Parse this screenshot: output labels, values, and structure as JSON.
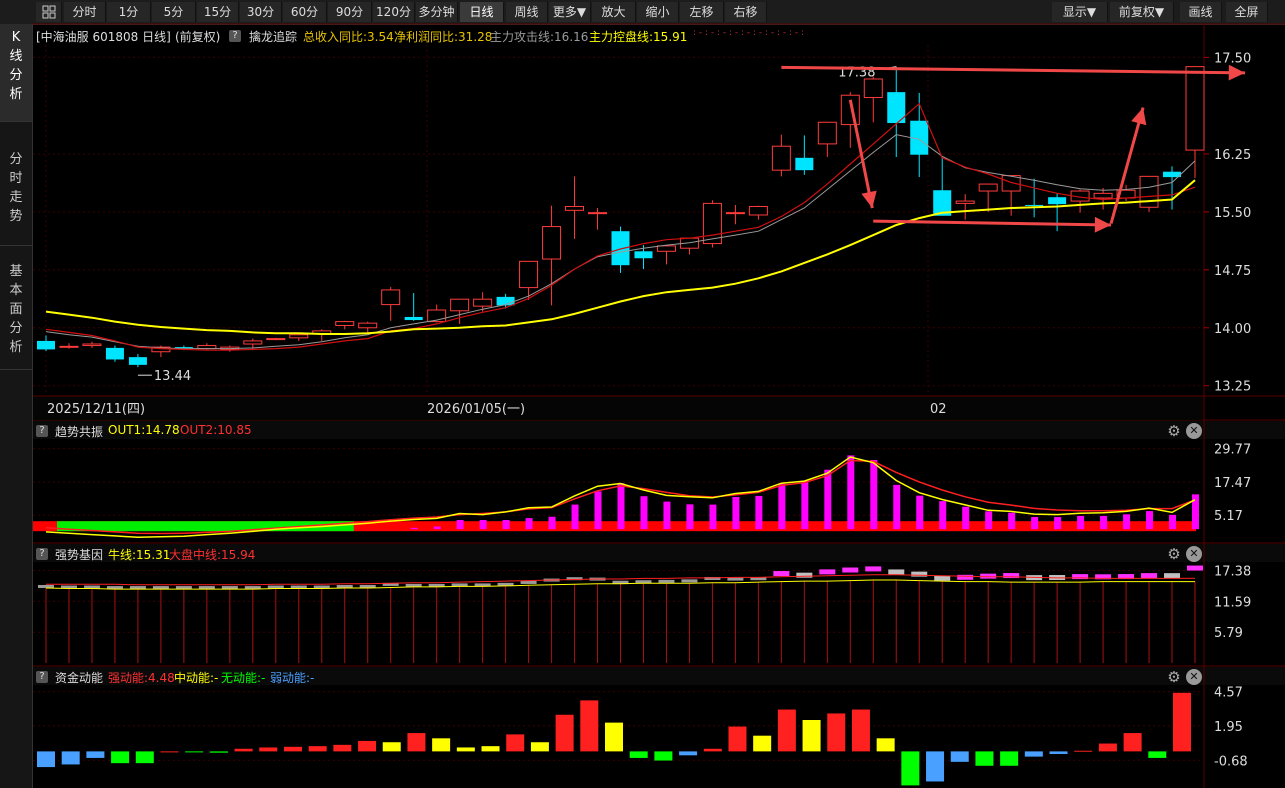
{
  "toolbar": {
    "items": [
      "分时",
      "1分",
      "5分",
      "15分",
      "30分",
      "60分",
      "90分",
      "120分",
      "多分钟",
      "日线",
      "周线",
      "更多▼",
      "放大",
      "缩小",
      "左移",
      "右移"
    ],
    "active": "日线",
    "right_items": [
      "显示▼",
      "前复权▼",
      "画线",
      "全屏"
    ]
  },
  "sidebar": {
    "tabs": [
      {
        "label": "K线分析",
        "chars": [
          "K",
          "线",
          "分",
          "析"
        ],
        "active": true
      },
      {
        "label": "分时走势",
        "chars": [
          "分",
          "时",
          "走",
          "势"
        ],
        "active": false
      },
      {
        "label": "基本面分析",
        "chars": [
          "基",
          "本",
          "面",
          "分",
          "析"
        ],
        "active": false
      }
    ]
  },
  "main_panel": {
    "title": "[中海油服 601808 日线]",
    "adjust": "(前复权)",
    "indicator_name": "擒龙追踪",
    "items": [
      {
        "text": "总收入同比:3.54",
        "color": "#e8c400"
      },
      {
        "text": "净利润同比:31.28",
        "color": "#e8c400"
      },
      {
        "text": "主力攻击线:16.16",
        "color": "#9a9a9a"
      },
      {
        "text": "主力控盘线:15.91",
        "color": "#ffff00"
      }
    ],
    "y_ticks": [
      "17.50",
      "16.25",
      "15.50",
      "14.75",
      "14.00",
      "13.25"
    ],
    "x_labels": [
      "2025/12/11(四)",
      "2026/01/05(一)",
      "02"
    ],
    "high_label": "17.38",
    "low_label": "13.44"
  },
  "chart_data": {
    "type": "candlestick",
    "open": [
      13.83,
      13.76,
      13.77,
      13.74,
      13.62,
      13.69,
      13.75,
      13.73,
      13.72,
      13.79,
      13.86,
      13.87,
      13.92,
      14.03,
      14.0,
      14.3,
      14.14,
      14.08,
      14.22,
      14.28,
      14.4,
      14.52,
      14.89,
      15.52,
      15.48,
      15.25,
      14.99,
      14.99,
      15.03,
      15.09,
      15.49,
      15.46,
      16.04,
      16.2,
      16.38,
      16.63,
      16.98,
      17.05,
      16.68,
      15.78,
      15.61,
      15.77,
      15.77,
      15.59,
      15.69,
      15.64,
      15.68,
      15.68,
      15.56,
      16.02,
      16.3
    ],
    "high": [
      13.9,
      13.8,
      13.82,
      13.77,
      13.66,
      13.77,
      13.77,
      13.8,
      13.77,
      13.86,
      13.87,
      13.92,
      13.98,
      14.09,
      14.08,
      14.53,
      14.45,
      14.3,
      14.35,
      14.46,
      14.44,
      14.55,
      15.58,
      15.96,
      15.55,
      15.31,
      15.07,
      15.05,
      15.14,
      15.65,
      15.59,
      15.58,
      16.5,
      16.49,
      16.62,
      17.05,
      17.25,
      17.38,
      17.04,
      16.22,
      15.73,
      15.77,
      15.97,
      15.93,
      15.74,
      15.79,
      15.81,
      15.85,
      15.95,
      16.09,
      16.41
    ],
    "low": [
      13.7,
      13.73,
      13.74,
      13.56,
      13.49,
      13.62,
      13.71,
      13.72,
      13.69,
      13.71,
      13.84,
      13.83,
      13.83,
      13.98,
      13.94,
      14.09,
      14.09,
      14.07,
      14.05,
      14.21,
      14.25,
      14.36,
      14.29,
      15.15,
      15.27,
      14.71,
      14.76,
      14.82,
      14.95,
      15.04,
      15.34,
      15.4,
      15.96,
      15.98,
      16.21,
      16.33,
      16.66,
      16.21,
      15.95,
      15.45,
      15.4,
      15.5,
      15.45,
      15.43,
      15.25,
      15.49,
      15.53,
      15.64,
      15.5,
      15.53,
      15.94
    ],
    "close": [
      13.72,
      13.76,
      13.79,
      13.59,
      13.52,
      13.75,
      13.74,
      13.77,
      13.75,
      13.83,
      13.86,
      13.91,
      13.96,
      14.08,
      14.06,
      14.49,
      14.1,
      14.23,
      14.37,
      14.37,
      14.29,
      14.86,
      15.31,
      15.57,
      15.49,
      14.81,
      14.9,
      15.06,
      15.16,
      15.61,
      15.49,
      15.57,
      16.35,
      16.04,
      16.66,
      17.01,
      17.22,
      16.65,
      16.24,
      15.45,
      15.64,
      15.86,
      15.97,
      15.58,
      15.6,
      15.77,
      15.74,
      15.78,
      15.96,
      15.95,
      17.38
    ],
    "ma_short": [
      13.98,
      13.94,
      13.9,
      13.83,
      13.75,
      13.73,
      13.72,
      13.71,
      13.71,
      13.72,
      13.73,
      13.75,
      13.79,
      13.83,
      13.86,
      13.96,
      13.99,
      14.05,
      14.13,
      14.2,
      14.26,
      14.38,
      14.55,
      14.76,
      14.93,
      15.02,
      15.09,
      15.14,
      15.16,
      15.2,
      15.25,
      15.3,
      15.44,
      15.62,
      15.86,
      16.12,
      16.38,
      16.64,
      16.9,
      16.2,
      16.08,
      15.99,
      15.88,
      15.81,
      15.74,
      15.69,
      15.66,
      15.68,
      15.7,
      15.72,
      15.82
    ],
    "ma_attack": [
      13.95,
      13.91,
      13.88,
      13.82,
      13.76,
      13.74,
      13.73,
      13.73,
      13.73,
      13.74,
      13.76,
      13.78,
      13.82,
      13.87,
      13.91,
      14.0,
      14.05,
      14.1,
      14.17,
      14.24,
      14.3,
      14.41,
      14.57,
      14.76,
      14.92,
      14.98,
      15.03,
      15.07,
      15.1,
      15.15,
      15.2,
      15.25,
      15.4,
      15.55,
      15.79,
      16.03,
      16.27,
      16.5,
      16.44,
      16.22,
      16.07,
      16.01,
      15.96,
      15.91,
      15.85,
      15.8,
      15.78,
      15.79,
      15.82,
      15.88,
      16.16
    ],
    "ma_control": [
      14.21,
      14.17,
      14.13,
      14.08,
      14.04,
      14.01,
      13.99,
      13.97,
      13.96,
      13.94,
      13.93,
      13.93,
      13.92,
      13.92,
      13.93,
      13.95,
      13.98,
      13.99,
      14.0,
      14.02,
      14.03,
      14.07,
      14.11,
      14.18,
      14.26,
      14.34,
      14.41,
      14.46,
      14.49,
      14.52,
      14.57,
      14.64,
      14.73,
      14.84,
      14.95,
      15.07,
      15.2,
      15.33,
      15.42,
      15.49,
      15.51,
      15.53,
      15.55,
      15.56,
      15.57,
      15.59,
      15.61,
      15.62,
      15.64,
      15.66,
      15.91
    ],
    "y_range": [
      13.13,
      17.66
    ],
    "annotations": {
      "high": 17.38,
      "low": 13.44
    }
  },
  "panel_trend": {
    "name": "趋势共振",
    "out1": "OUT1:14.78",
    "out2": "OUT2:10.85",
    "y_ticks": [
      "29.77",
      "17.47",
      "5.17"
    ],
    "chart_data": {
      "type": "bar_line",
      "bars": [
        0,
        0,
        0,
        0,
        0,
        0,
        0,
        0,
        0,
        0,
        0,
        0,
        0,
        0,
        0,
        0,
        0.5,
        1.0,
        3.4,
        3.4,
        3.4,
        4.1,
        4.6,
        9.1,
        14.0,
        17.0,
        12.2,
        10.2,
        9.2,
        9.1,
        11.9,
        12.3,
        16.8,
        17.9,
        22.0,
        27.3,
        25.6,
        16.4,
        12.4,
        10.4,
        8.3,
        6.6,
        6.1,
        4.5,
        4.5,
        4.9,
        4.9,
        5.5,
        6.7,
        5.3,
        12.9
      ],
      "out1": [
        -1,
        -1.5,
        -2,
        -2.5,
        -3,
        -2.8,
        -2.6,
        -2,
        -1.5,
        -0.8,
        0,
        0.5,
        1,
        1.6,
        2.2,
        3,
        3.6,
        4,
        5.8,
        5.4,
        6.4,
        7.9,
        8.2,
        12.3,
        15.9,
        16.9,
        14.5,
        12.5,
        12.0,
        11.6,
        13.2,
        14.0,
        17.0,
        17.8,
        20.7,
        26.7,
        24.6,
        18.0,
        13.5,
        11.0,
        9.0,
        7.0,
        6.6,
        5.6,
        5.4,
        5.9,
        6.1,
        6.6,
        7.8,
        6.2,
        10.9
      ],
      "out2": [
        0.5,
        0,
        -0.5,
        -1,
        -1.5,
        -1.6,
        -1.5,
        -1.2,
        -0.8,
        -0.2,
        0.4,
        1,
        1.6,
        2.2,
        2.8,
        3.5,
        4.1,
        4.5,
        5.4,
        5.8,
        6.4,
        7.5,
        8.0,
        11.2,
        14.2,
        16.0,
        15.0,
        13.6,
        12.4,
        11.9,
        12.7,
        13.6,
        16.2,
        17.2,
        19.8,
        25.4,
        25.1,
        21.0,
        17.5,
        14.5,
        12.0,
        10.0,
        8.9,
        7.7,
        7.1,
        6.8,
        6.8,
        7.0,
        7.6,
        7.6,
        10.85
      ],
      "band": {
        "green_until_index": 13
      },
      "y_range": [
        -4,
        33
      ]
    }
  },
  "panel_gene": {
    "name": "强势基因",
    "bull": "牛线:15.31",
    "market": "大盘中线:15.94",
    "y_ticks": [
      "17.38",
      "11.59",
      "5.79"
    ],
    "chart_data": {
      "type": "bar_line",
      "y_range": [
        0,
        18.8
      ],
      "bull": [
        14.1,
        14.0,
        14.0,
        13.9,
        13.9,
        13.9,
        13.9,
        13.9,
        13.9,
        13.9,
        14.0,
        14.0,
        14.0,
        14.1,
        14.1,
        14.2,
        14.3,
        14.3,
        14.4,
        14.4,
        14.5,
        14.6,
        14.7,
        14.8,
        14.9,
        14.9,
        15.0,
        15.0,
        15.0,
        15.1,
        15.1,
        15.2,
        15.3,
        15.4,
        15.4,
        15.5,
        15.6,
        15.6,
        15.5,
        15.4,
        15.3,
        15.3,
        15.2,
        15.2,
        15.2,
        15.2,
        15.3,
        15.3,
        15.3,
        15.3,
        15.31
      ],
      "market": [
        14.8,
        14.8,
        14.8,
        14.8,
        14.7,
        14.7,
        14.7,
        14.7,
        14.7,
        14.7,
        14.8,
        14.8,
        14.8,
        14.9,
        14.9,
        15.0,
        15.1,
        15.1,
        15.2,
        15.3,
        15.4,
        15.5,
        15.6,
        15.7,
        15.8,
        15.8,
        15.9,
        15.9,
        16.0,
        16.0,
        16.1,
        16.1,
        16.2,
        16.3,
        16.4,
        16.5,
        16.6,
        16.6,
        16.5,
        16.4,
        16.3,
        16.2,
        16.2,
        16.1,
        16.0,
        16.0,
        15.9,
        15.9,
        15.9,
        15.9,
        15.94
      ],
      "tag_color_index_from": 32
    }
  },
  "panel_fund": {
    "name": "资金动能",
    "strong": "强动能:4.48",
    "medium": "中动能:-",
    "none": "无动能:-",
    "weak": "弱动能:-",
    "y_ticks": [
      "4.57",
      "1.95",
      "-0.68"
    ],
    "chart_data": {
      "type": "bar",
      "y_range": [
        -2.8,
        5.0
      ],
      "values": [
        -1.2,
        -1.0,
        -0.5,
        -0.9,
        -0.9,
        -0.05,
        -0.05,
        -0.1,
        0.2,
        0.3,
        0.35,
        0.4,
        0.5,
        0.8,
        0.7,
        1.4,
        1.0,
        0.3,
        0.4,
        1.3,
        0.7,
        2.8,
        3.9,
        2.2,
        -0.5,
        -0.7,
        -0.3,
        0.2,
        1.9,
        1.2,
        3.2,
        2.4,
        2.9,
        3.2,
        1.0,
        -2.6,
        -2.3,
        -0.8,
        -1.1,
        -1.1,
        -0.4,
        -0.2,
        0.05,
        0.6,
        1.4,
        -0.5,
        4.48
      ],
      "colors": [
        "#4aa0ff",
        "#4aa0ff",
        "#4aa0ff",
        "#00ff00",
        "#00ff00",
        "#ff2020",
        "#00ff00",
        "#00ff00",
        "#ff2020",
        "#ff2020",
        "#ff2020",
        "#ff2020",
        "#ff2020",
        "#ff2020",
        "#ffff00",
        "#ff2020",
        "#ffff00",
        "#ffff00",
        "#ffff00",
        "#ff2020",
        "#ffff00",
        "#ff2020",
        "#ff2020",
        "#ffff00",
        "#00ff00",
        "#00ff00",
        "#4aa0ff",
        "#ff2020",
        "#ff2020",
        "#ffff00",
        "#ff2020",
        "#ffff00",
        "#ff2020",
        "#ff2020",
        "#ffff00",
        "#00ff00",
        "#4aa0ff",
        "#4aa0ff",
        "#00ff00",
        "#00ff00",
        "#4aa0ff",
        "#4aa0ff",
        "#ff2020",
        "#ff2020",
        "#ff2020",
        "#00ff00",
        "#ff2020"
      ]
    }
  }
}
